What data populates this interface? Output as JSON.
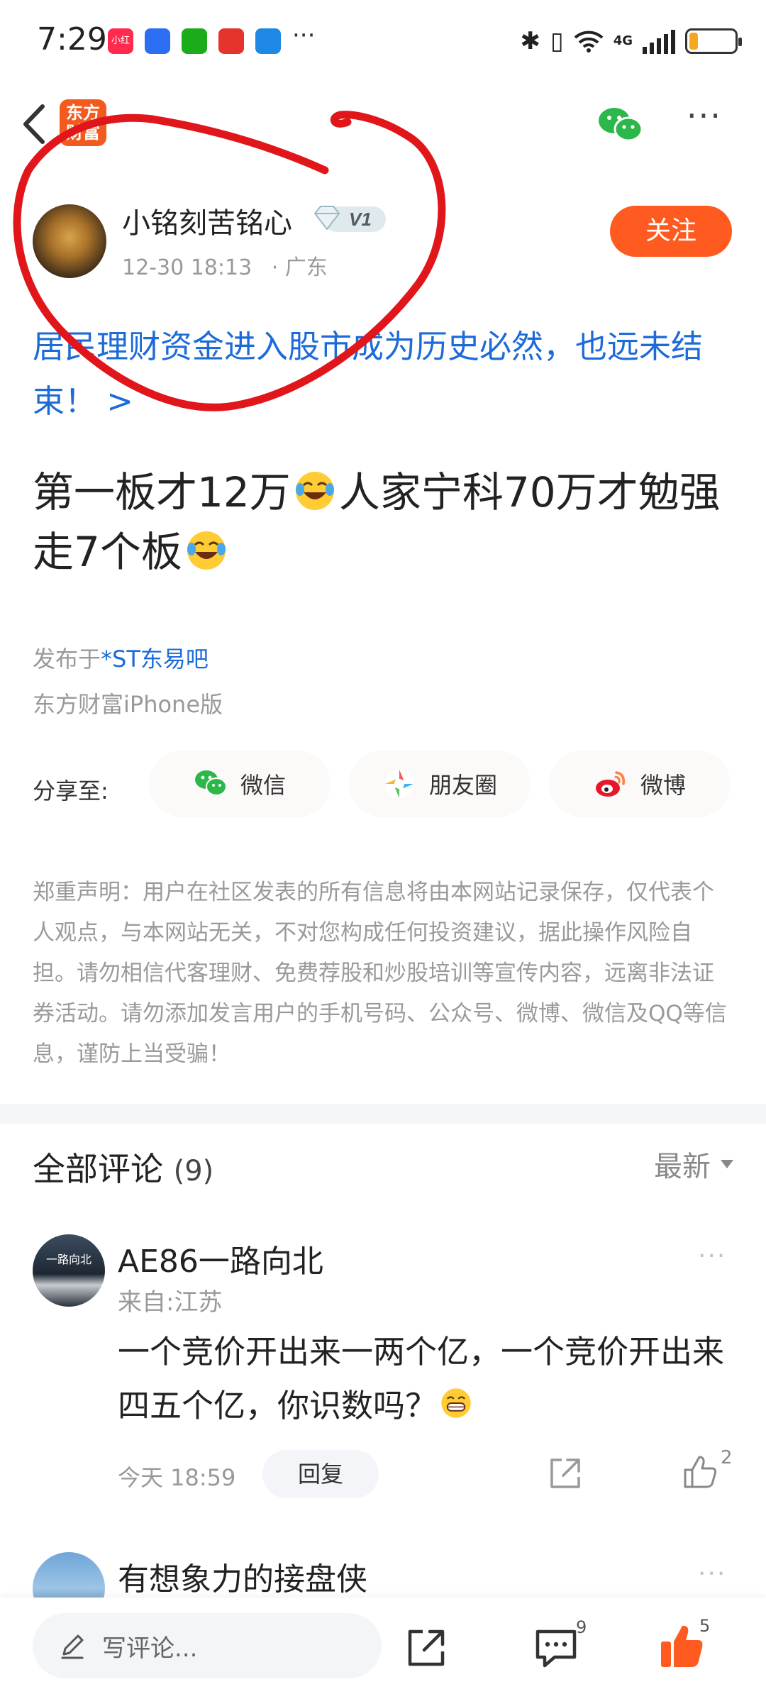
{
  "status_bar": {
    "time": "7:29",
    "app_icons": [
      "小红书",
      "app-icon",
      "wechat-icon",
      "netease-icon",
      "browser-icon"
    ],
    "more": "···",
    "network": "4G",
    "battery_level": 0.2,
    "battery_color": "#f5a623"
  },
  "nav": {
    "logo_text": "东方财富",
    "more": "···"
  },
  "author": {
    "name": "小铭刻苦铭心",
    "level": "V1",
    "time": "12-30 18:13",
    "location": "· 广东",
    "follow_label": "关注"
  },
  "topic_link": "居民理财资金进入股市成为历史必然，也远未结束！ >",
  "post": {
    "title_part1": "第一板才12万",
    "title_part2": "人家宁科70万才勉强走7个板",
    "emoji": "laughing-crying-emoji",
    "published_prefix": "发布于",
    "forum": "*ST东易吧",
    "client": "东方财富iPhone版"
  },
  "share": {
    "label": "分享至:",
    "wechat": "微信",
    "moments": "朋友圈",
    "weibo": "微博"
  },
  "disclaimer": "郑重声明：用户在社区发表的所有信息将由本网站记录保存，仅代表个人观点，与本网站无关，不对您构成任何投资建议，据此操作风险自担。请勿相信代客理财、免费荐股和炒股培训等宣传内容，远离非法证券活动。请勿添加发言用户的手机号码、公众号、微博、微信及QQ等信息，谨防上当受骗！",
  "comments": {
    "title": "全部评论",
    "count": "(9)",
    "sort_label": "最新",
    "items": [
      {
        "name": "AE86一路向北",
        "avatar_text": "一路向北",
        "from": "来自:江苏",
        "text": "一个竞价开出来一两个亿，一个竞价开出来四五个亿，你识数吗？",
        "emoji": "grinning-emoji",
        "time": "今天 18:59",
        "reply_label": "回复",
        "likes": "2",
        "more": "···"
      },
      {
        "name": "有想象力的接盘侠",
        "more": "···"
      }
    ]
  },
  "bottom_bar": {
    "write_placeholder": "写评论...",
    "comment_count": "9",
    "like_count": "5",
    "accent": "#ff5a1f"
  },
  "annotation_color": "#e0161b"
}
